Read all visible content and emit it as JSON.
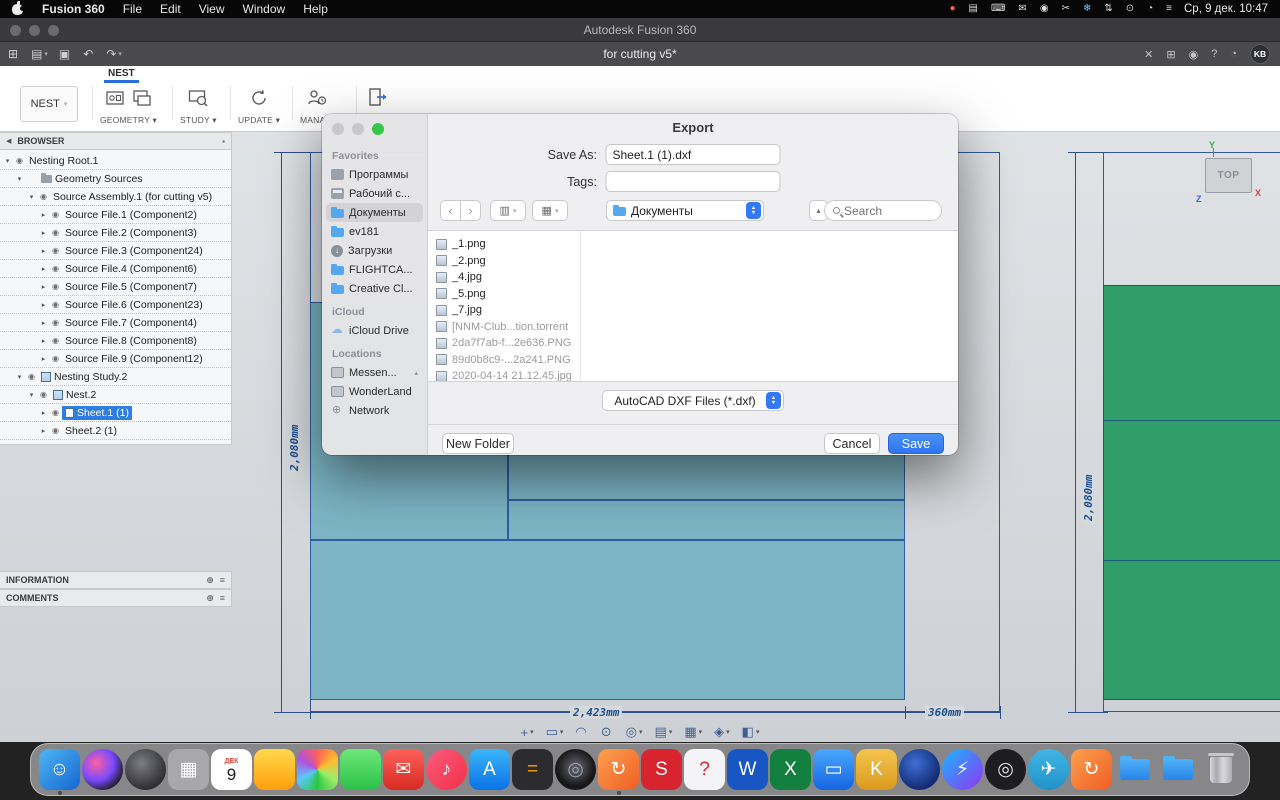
{
  "menubar": {
    "items": [
      "Fusion 360",
      "File",
      "Edit",
      "View",
      "Window",
      "Help"
    ],
    "status_icons": [
      {
        "g": "●",
        "c": "#ff5d55"
      },
      {
        "g": "▤"
      },
      {
        "g": "⌨"
      },
      {
        "g": "✉"
      },
      {
        "g": "◉"
      },
      {
        "g": "✂"
      },
      {
        "g": "❄",
        "c": "#79c2ff"
      },
      {
        "g": "⇅"
      },
      {
        "g": "⊙"
      },
      {
        "g": "◔"
      },
      {
        "g": "≡"
      }
    ],
    "clock": "Ср, 9 дек. 10:47"
  },
  "titlebar": {
    "title": "Autodesk Fusion 360"
  },
  "tabbar": {
    "qat": [
      {
        "g": "⊞",
        "caret": ""
      },
      {
        "g": "▤",
        "caret": "▾"
      },
      {
        "g": "▣",
        "caret": ""
      },
      {
        "g": "↶",
        "caret": ""
      },
      {
        "g": "↷",
        "caret": "▾"
      }
    ],
    "tab_title": "for cutting v5*",
    "close": "✕",
    "right_icons": [
      {
        "g": "⊞"
      },
      {
        "g": "◉"
      },
      {
        "g": "?"
      },
      {
        "g": "◔"
      }
    ],
    "avatar": "KB"
  },
  "ribbon": {
    "tab": "NEST",
    "nest_button": "NEST",
    "nest_caret": "▾",
    "group_labels": {
      "geometry": "GEOMETRY ▾",
      "study": "STUDY ▾",
      "update": "UPDATE ▾",
      "manage": "MANA..."
    }
  },
  "browser": {
    "header": "BROWSER",
    "tree": [
      {
        "label": "Nesting Root.1",
        "pad": "2px",
        "d": "▾",
        "e": "◉"
      },
      {
        "label": "Geometry Sources",
        "pad": "14px",
        "d": "▾",
        "e": "",
        "ic": "folder"
      },
      {
        "label": "Source Assembly.1 (for cutting v5)",
        "pad": "26px",
        "d": "▾",
        "e": "◉"
      },
      {
        "label": "Source File.1 (Component2)",
        "pad": "38px",
        "d": "▸",
        "e": "◉"
      },
      {
        "label": "Source File.2 (Component3)",
        "pad": "38px",
        "d": "▸",
        "e": "◉"
      },
      {
        "label": "Source File.3 (Component24)",
        "pad": "38px",
        "d": "▸",
        "e": "◉"
      },
      {
        "label": "Source File.4 (Component6)",
        "pad": "38px",
        "d": "▸",
        "e": "◉"
      },
      {
        "label": "Source File.5 (Component7)",
        "pad": "38px",
        "d": "▸",
        "e": "◉"
      },
      {
        "label": "Source File.6 (Component23)",
        "pad": "38px",
        "d": "▸",
        "e": "◉"
      },
      {
        "label": "Source File.7 (Component4)",
        "pad": "38px",
        "d": "▸",
        "e": "◉"
      },
      {
        "label": "Source File.8 (Component8)",
        "pad": "38px",
        "d": "▸",
        "e": "◉"
      },
      {
        "label": "Source File.9 (Component12)",
        "pad": "38px",
        "d": "▸",
        "e": "◉"
      },
      {
        "label": "Nesting Study.2",
        "pad": "14px",
        "d": "▾",
        "e": "◉",
        "ic": "grid"
      },
      {
        "label": "Nest.2",
        "pad": "26px",
        "d": "▾",
        "e": "◉",
        "ic": "grid"
      },
      {
        "label": "Sheet.1 (1)",
        "pad": "38px",
        "d": "▸",
        "e": "◉",
        "ic": "sheet",
        "sel": true
      },
      {
        "label": "Sheet.2 (1)",
        "pad": "38px",
        "d": "▸",
        "e": "◉"
      }
    ],
    "info": "INFORMATION",
    "comments": "COMMENTS"
  },
  "canvas": {
    "dim_left": "2,080mm",
    "dim_bottom": "2,423mm",
    "dim_bottom2": "360mm",
    "dim_right": "2,080mm",
    "viewcube": "TOP",
    "axis_x": "X",
    "axis_y": "Y",
    "axis_z": "Z",
    "nav_icons": [
      {
        "g": "+",
        "caret": "▾"
      },
      {
        "g": "▭",
        "caret": "▾"
      },
      {
        "g": "◠",
        "caret": ""
      },
      {
        "g": "⊙",
        "caret": ""
      },
      {
        "g": "◎",
        "caret": "▾"
      },
      {
        "g": "▤",
        "caret": "▾"
      },
      {
        "g": "▦",
        "caret": "▾"
      },
      {
        "g": "◈",
        "caret": "▾"
      },
      {
        "g": "◧",
        "caret": "▾"
      }
    ]
  },
  "dialog": {
    "title": "Export",
    "save_as_label": "Save As:",
    "save_as_value": "Sheet.1 (1).dxf",
    "tags_label": "Tags:",
    "back": "‹",
    "forward": "›",
    "view_column_icon": "▥",
    "view_grid_icon": "▦",
    "caret": "▾",
    "up": "▴",
    "stepper_up": "▲",
    "stepper_down": "▼",
    "location": "Документы",
    "search_placeholder": "Search",
    "sidebar": {
      "favorites_header": "Favorites",
      "favorites": [
        {
          "label": "Программы",
          "ic": "grid2"
        },
        {
          "label": "Рабочий с...",
          "ic": "desk"
        },
        {
          "label": "Документы",
          "ic": "folder2",
          "sel": true
        },
        {
          "label": "ev181",
          "ic": "folder2"
        },
        {
          "label": "Загрузки",
          "ic": "down"
        },
        {
          "label": "FLIGHTCA...",
          "ic": "folder2"
        },
        {
          "label": "Creative Cl...",
          "ic": "folder2"
        }
      ],
      "icloud_header": "iCloud",
      "icloud": [
        {
          "label": "iCloud Drive",
          "ic": "cloud"
        }
      ],
      "locations_header": "Locations",
      "locations": [
        {
          "label": "Messen...",
          "ic": "disk",
          "eject": "▴"
        },
        {
          "label": "WonderLand",
          "ic": "disk"
        },
        {
          "label": "Network",
          "ic": "globe"
        }
      ]
    },
    "files": [
      {
        "name": "_1.png"
      },
      {
        "name": "_2.png"
      },
      {
        "name": "_4.jpg"
      },
      {
        "name": "_5.png"
      },
      {
        "name": "_7.jpg"
      },
      {
        "name": "[NNM-Club...tion.torrent",
        "dim": true
      },
      {
        "name": "2da7f7ab-f...2e636.PNG",
        "dim": true
      },
      {
        "name": "89d0b8c9-...2a241.PNG",
        "dim": true
      },
      {
        "name": "2020-04-14 21.12.45.jpg",
        "dim": true
      }
    ],
    "format_value": "AutoCAD DXF Files (*.dxf)",
    "new_folder_label": "New Folder",
    "cancel_label": "Cancel",
    "save_label": "Save"
  },
  "dock": {
    "items": [
      {
        "name": "finder",
        "bg": "linear-gradient(135deg,#4db5f5,#1667cf)",
        "fg": "#fff",
        "g": "☺",
        "run": true
      },
      {
        "name": "siri",
        "shape": "circle",
        "bg": "radial-gradient(circle at 35% 35%,#ff5fa2,#7a4bff 45%,#1b1b1f 78%)",
        "g": ""
      },
      {
        "name": "settings-sphere",
        "shape": "circle",
        "bg": "radial-gradient(circle at 40% 35%,#7d7d85,#2e2e33 72%)",
        "g": ""
      },
      {
        "name": "launchpad",
        "bg": "rgba(255,255,255,0.28)",
        "fg": "#fff",
        "g": "▦"
      },
      {
        "name": "calendar",
        "shape": "cal",
        "sub": "ДЕК",
        "g": "9"
      },
      {
        "name": "notes",
        "bg": "linear-gradient(#ffd94d,#ff9f0a)",
        "fg": "#fff",
        "g": ""
      },
      {
        "name": "photos",
        "bg": "conic-gradient(from 0deg,#ff5f57,#ffbd2e,#9ded6c,#28c840,#5ac8fa,#af52de,#ff5f57)",
        "g": ""
      },
      {
        "name": "green-app",
        "bg": "linear-gradient(#6ee87a,#2bc148)",
        "fg": "#fff",
        "g": ""
      },
      {
        "name": "mail",
        "bg": "linear-gradient(#ff6159,#d62b23)",
        "fg": "#fff",
        "g": "✉"
      },
      {
        "name": "music",
        "shape": "circle",
        "bg": "linear-gradient(135deg,#fc5c7d,#f23048)",
        "fg": "#fff",
        "g": "♪"
      },
      {
        "name": "app-store",
        "bg": "linear-gradient(#3ab5f8,#0b72e8)",
        "fg": "#fff",
        "g": "A"
      },
      {
        "name": "calculator",
        "bg": "#2c2c2e",
        "fg": "#ff9f0a",
        "g": "="
      },
      {
        "name": "camera-lens",
        "shape": "circle",
        "bg": "radial-gradient(circle at 50% 45%,#55555c 15%,#17171a 62%)",
        "fg": "#9aa4ae",
        "g": "◎"
      },
      {
        "name": "fusion-360",
        "bg": "linear-gradient(135deg,#ffa14e,#ef5d24)",
        "fg": "#fff",
        "g": "↻",
        "run": true
      },
      {
        "name": "sketchup",
        "bg": "#d8242f",
        "fg": "#fff",
        "g": "S"
      },
      {
        "name": "help",
        "bg": "#f4f4f6",
        "fg": "#d8242f",
        "g": "?"
      },
      {
        "name": "word",
        "bg": "#1857c3",
        "fg": "#fff",
        "g": "W"
      },
      {
        "name": "excel",
        "bg": "#13803f",
        "fg": "#fff",
        "g": "X"
      },
      {
        "name": "video-call",
        "bg": "linear-gradient(#4aa8ff,#1565e0)",
        "fg": "#fff",
        "g": "▭"
      },
      {
        "name": "gold-app",
        "bg": "linear-gradient(#f4c64e,#d99a1f)",
        "fg": "#fff",
        "g": "K"
      },
      {
        "name": "navy-sphere",
        "shape": "circle",
        "bg": "radial-gradient(circle at 40% 35%,#3f6fd4,#122a72 72%)",
        "g": ""
      },
      {
        "name": "messenger",
        "shape": "circle",
        "bg": "linear-gradient(135deg,#19b8ff,#9333f5)",
        "fg": "#fff",
        "g": "⚡"
      },
      {
        "name": "obs",
        "shape": "circle",
        "bg": "#1d1d21",
        "fg": "#dfe3e8",
        "g": "◎"
      },
      {
        "name": "telegram",
        "shape": "circle",
        "bg": "linear-gradient(#41b5e5,#2192c9)",
        "fg": "#fff",
        "g": "✈"
      },
      {
        "name": "fusion-360-alt",
        "bg": "linear-gradient(135deg,#ffa14e,#ef5d24)",
        "fg": "#fff",
        "g": "↻"
      },
      {
        "name": "folder-1",
        "shape": "folder3",
        "g": ""
      },
      {
        "name": "folder-2",
        "shape": "folder3",
        "g": ""
      },
      {
        "name": "trash",
        "shape": "trash",
        "g": ""
      }
    ]
  }
}
